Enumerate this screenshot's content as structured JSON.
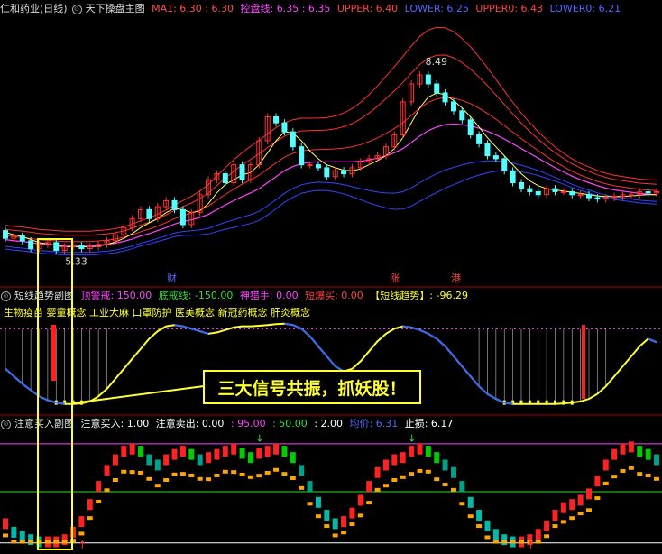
{
  "main_panel": {
    "stock": "仁和药业(日线)",
    "title": "天下操盘主图",
    "ma1_label": "MA1: 6.30 : 6.30",
    "kongpan_label": "控盘线: 6.35 : 6.35",
    "upper_label": "UPPER: 6.40",
    "lower_label": "LOWER: 6.25",
    "upper0_label": "UPPER0: 6.43",
    "lower0_label": "LOWER0: 6.21",
    "high_mark": "8.49",
    "low_mark": "5.33",
    "event_labels": [
      "财",
      "涨",
      "港"
    ]
  },
  "sub1": {
    "title": "短线趋势副图",
    "ding_label": "顶警戒: 150.00",
    "di_label": "底戒线: -150.00",
    "shen_label": "神猎手: 0.00",
    "bao_label": "短爆买: 0.00",
    "trend_label": "【短线趋势】: -96.29",
    "concepts": "生物疫苗 婴童概念 工业大麻 口罩防护 医美概念 新冠药概念 肝炎概念"
  },
  "sub2": {
    "title": "注意买入副图",
    "buy_label": "注意买入: 1.00",
    "sell_label": "注意卖出: 0.00",
    "v1": ": 95.00",
    "v2": ": 50.00",
    "v3": ": 2.00",
    "jun_label": "均价: 6.31",
    "stop_label": "止损: 6.17"
  },
  "callout_text": "三大信号共振，抓妖股！",
  "colors": {
    "up": "#ff3232",
    "down": "#54ffff",
    "ma1": "#ffffff",
    "kongpan": "#ff44ff",
    "upper": "#ff3232",
    "lower": "#3344ff",
    "trend": "#ffff33",
    "yellow": "#ffff33",
    "green": "#00cc00",
    "orange": "#ffa500",
    "teal": "#00a08a"
  },
  "chart_data": [
    {
      "type": "candlestick",
      "title": "天下操盘主图",
      "ylim": [
        4.9,
        9.3
      ],
      "opens": [
        5.75,
        5.62,
        5.66,
        5.58,
        5.45,
        5.52,
        5.55,
        5.42,
        5.48,
        5.5,
        5.45,
        5.48,
        5.52,
        5.58,
        5.68,
        5.8,
        5.95,
        6.1,
        5.95,
        6.15,
        6.25,
        6.1,
        5.85,
        6.05,
        6.35,
        6.6,
        6.7,
        6.55,
        6.85,
        6.6,
        6.85,
        7.25,
        7.65,
        7.55,
        7.4,
        7.15,
        6.85,
        6.85,
        6.8,
        6.65,
        6.75,
        6.7,
        6.8,
        6.9,
        6.95,
        7.0,
        7.15,
        7.35,
        7.9,
        8.2,
        8.35,
        8.2,
        8.05,
        7.9,
        7.75,
        7.6,
        7.35,
        7.2,
        7.0,
        6.95,
        6.75,
        6.55,
        6.45,
        6.4,
        6.35,
        6.45,
        6.4,
        6.4,
        6.35,
        6.35,
        6.3,
        6.28,
        6.3,
        6.32,
        6.35,
        6.35,
        6.4,
        6.38
      ],
      "closes": [
        5.62,
        5.66,
        5.58,
        5.45,
        5.52,
        5.55,
        5.42,
        5.48,
        5.5,
        5.45,
        5.48,
        5.52,
        5.58,
        5.68,
        5.8,
        5.95,
        6.1,
        5.95,
        6.15,
        6.25,
        6.1,
        5.85,
        6.05,
        6.35,
        6.6,
        6.7,
        6.55,
        6.85,
        6.6,
        6.85,
        7.25,
        7.65,
        7.55,
        7.4,
        7.15,
        6.85,
        6.85,
        6.8,
        6.65,
        6.75,
        6.7,
        6.8,
        6.9,
        6.95,
        7.0,
        7.15,
        7.35,
        7.9,
        8.2,
        8.35,
        8.2,
        8.05,
        7.9,
        7.75,
        7.6,
        7.35,
        7.2,
        7.0,
        6.95,
        6.75,
        6.55,
        6.45,
        6.4,
        6.35,
        6.45,
        6.4,
        6.4,
        6.35,
        6.35,
        6.3,
        6.28,
        6.3,
        6.32,
        6.35,
        6.35,
        6.4,
        6.38,
        6.4
      ],
      "series": [
        {
          "name": "MA1",
          "values": [
            5.72,
            5.68,
            5.65,
            5.6,
            5.55,
            5.53,
            5.5,
            5.48,
            5.48,
            5.48,
            5.48,
            5.49,
            5.52,
            5.56,
            5.62,
            5.7,
            5.8,
            5.88,
            5.95,
            6.05,
            6.12,
            6.1,
            6.05,
            6.08,
            6.2,
            6.38,
            6.52,
            6.6,
            6.68,
            6.72,
            6.85,
            7.05,
            7.25,
            7.4,
            7.38,
            7.25,
            7.08,
            6.95,
            6.85,
            6.8,
            6.76,
            6.75,
            6.78,
            6.85,
            6.92,
            7.0,
            7.12,
            7.3,
            7.55,
            7.8,
            7.98,
            8.05,
            8.02,
            7.92,
            7.8,
            7.65,
            7.48,
            7.3,
            7.15,
            7.0,
            6.85,
            6.7,
            6.58,
            6.5,
            6.45,
            6.43,
            6.41,
            6.39,
            6.37,
            6.35,
            6.33,
            6.32,
            6.32,
            6.32,
            6.33,
            6.34,
            6.35,
            6.35
          ]
        },
        {
          "name": "控盘线",
          "values": [
            5.6,
            5.58,
            5.57,
            5.55,
            5.53,
            5.52,
            5.51,
            5.5,
            5.5,
            5.5,
            5.5,
            5.51,
            5.52,
            5.54,
            5.57,
            5.61,
            5.66,
            5.7,
            5.75,
            5.8,
            5.86,
            5.9,
            5.93,
            5.97,
            6.02,
            6.1,
            6.18,
            6.25,
            6.32,
            6.38,
            6.45,
            6.55,
            6.65,
            6.75,
            6.82,
            6.87,
            6.89,
            6.9,
            6.9,
            6.9,
            6.9,
            6.9,
            6.91,
            6.93,
            6.96,
            7.0,
            7.05,
            7.12,
            7.22,
            7.33,
            7.42,
            7.48,
            7.52,
            7.53,
            7.52,
            7.5,
            7.46,
            7.41,
            7.35,
            7.28,
            7.2,
            7.12,
            7.04,
            6.96,
            6.88,
            6.8,
            6.73,
            6.66,
            6.6,
            6.55,
            6.5,
            6.46,
            6.43,
            6.41,
            6.39,
            6.37,
            6.36,
            6.35
          ]
        }
      ]
    },
    {
      "type": "line",
      "title": "短线趋势副图",
      "ylim": [
        -180,
        180
      ],
      "series": [
        {
          "name": "短线趋势",
          "values": [
            -10,
            -40,
            -70,
            -95,
            -120,
            -135,
            -145,
            -150,
            -150,
            -148,
            -140,
            -120,
            -90,
            -50,
            -10,
            30,
            70,
            110,
            140,
            160,
            165,
            160,
            150,
            140,
            130,
            135,
            145,
            155,
            160,
            160,
            162,
            165,
            168,
            170,
            165,
            150,
            120,
            80,
            40,
            0,
            -20,
            -10,
            20,
            60,
            100,
            130,
            150,
            160,
            155,
            145,
            130,
            110,
            80,
            40,
            0,
            -40,
            -80,
            -110,
            -130,
            -145,
            -150,
            -150,
            -150,
            -150,
            -150,
            -150,
            -148,
            -145,
            -140,
            -130,
            -110,
            -80,
            -40,
            0,
            40,
            80,
            110,
            96
          ]
        }
      ]
    },
    {
      "type": "bar",
      "title": "注意买入副图",
      "ylim": [
        -5,
        105
      ],
      "series": [
        {
          "name": "注意买入",
          "values": [
            20,
            12,
            8,
            5,
            3,
            3,
            3,
            5,
            12,
            22,
            38,
            55,
            70,
            80,
            88,
            90,
            88,
            80,
            75,
            80,
            85,
            88,
            85,
            80,
            82,
            85,
            88,
            90,
            86,
            82,
            86,
            88,
            90,
            88,
            82,
            70,
            55,
            40,
            28,
            20,
            22,
            30,
            42,
            55,
            68,
            75,
            80,
            82,
            88,
            90,
            88,
            82,
            75,
            68,
            55,
            40,
            28,
            18,
            10,
            5,
            3,
            3,
            5,
            10,
            18,
            28,
            35,
            38,
            42,
            48,
            60,
            75,
            85,
            90,
            92,
            88,
            85,
            80
          ]
        }
      ]
    }
  ]
}
